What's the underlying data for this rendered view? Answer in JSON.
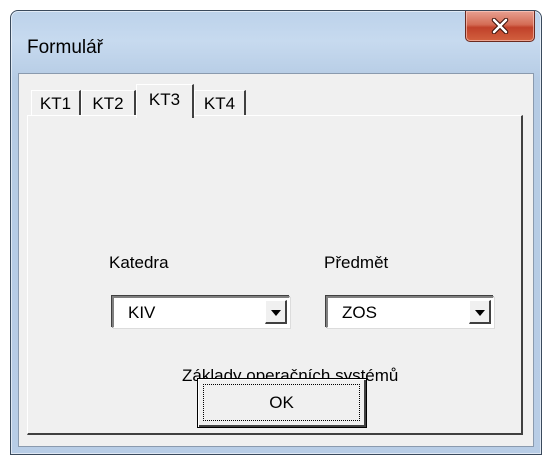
{
  "window": {
    "title": "Formulář"
  },
  "titlebar": {
    "close_icon": "close-icon"
  },
  "tabs": [
    {
      "label": "KT1",
      "active": false
    },
    {
      "label": "KT2",
      "active": false
    },
    {
      "label": "KT3",
      "active": true
    },
    {
      "label": "KT4",
      "active": false
    }
  ],
  "form": {
    "katedra_label": "Katedra",
    "katedra_value": "KIV",
    "predmet_label": "Předmět",
    "predmet_value": "ZOS",
    "course_name": "Základy operačních systémů",
    "ok_label": "OK"
  },
  "colors": {
    "close_button": "#c9503a",
    "dialog_background": "#f0f0f0",
    "frame": "#bcd2ea"
  }
}
